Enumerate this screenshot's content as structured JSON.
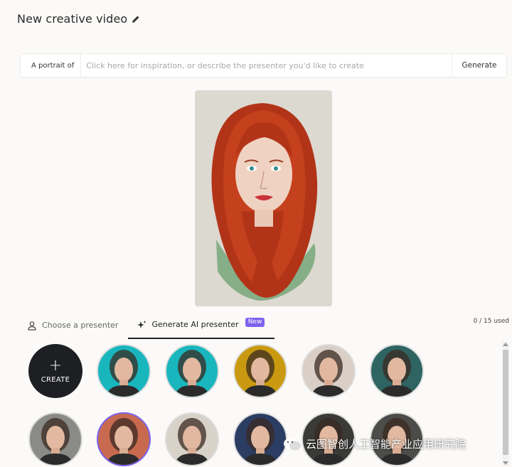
{
  "header": {
    "title": "New creative video",
    "edit_icon": "pencil-icon"
  },
  "prompt": {
    "label": "A portrait of",
    "placeholder": "Click here for inspiration, or describe the presenter you'd like to create",
    "value": "",
    "generate_label": "Generate"
  },
  "tabs": [
    {
      "label": "Choose a presenter",
      "icon": "person-icon",
      "active": false
    },
    {
      "label": "Generate AI presenter",
      "icon": "sparkle-icon",
      "active": true,
      "badge": "New"
    }
  ],
  "usage": "0 / 15 used",
  "create": {
    "label": "CREATE",
    "icon": "plus-icon"
  },
  "avatars": [
    {
      "name": "woman-dark-hair-teal",
      "bg": "#19b6be",
      "selected": false
    },
    {
      "name": "woman-tied-hair-teal",
      "bg": "#19b6be",
      "selected": false
    },
    {
      "name": "bald-figure-gold",
      "bg": "#c99a0f",
      "selected": false
    },
    {
      "name": "man-light-beige",
      "bg": "#d9cfc6",
      "selected": false
    },
    {
      "name": "woman-dark-teal",
      "bg": "#2e6462",
      "selected": false
    },
    {
      "name": "man-glasses",
      "bg": "#8a8a86",
      "selected": false
    },
    {
      "name": "woman-red-hair",
      "bg": "#c86a4f",
      "selected": true
    },
    {
      "name": "woman-dark-curly",
      "bg": "#d8d2c8",
      "selected": false
    },
    {
      "name": "woman-navy",
      "bg": "#2c3d64",
      "selected": false
    },
    {
      "name": "woman-dark-skin",
      "bg": "#3a3a38",
      "selected": false
    },
    {
      "name": "man-dark-skin",
      "bg": "#4c4c4a",
      "selected": false
    }
  ],
  "watermark": {
    "text": "云图智创人工智能产业应用研究院",
    "icon": "wechat-icon"
  }
}
